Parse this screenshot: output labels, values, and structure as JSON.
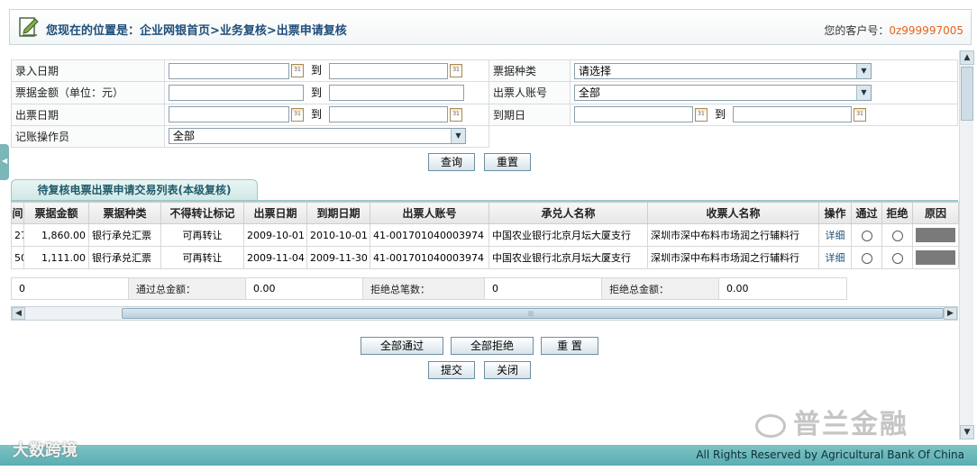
{
  "header": {
    "location": "您现在的位置是：企业网银首页>业务复核>出票申请复核",
    "customer_label": "您的客户号：",
    "customer_number": "0z999997005"
  },
  "form": {
    "to_label": "到",
    "entry_date_label": "录入日期",
    "bill_type_label": "票据种类",
    "bill_type_value": "请选择",
    "amount_label": "票据金额（单位：元）",
    "drawer_account_label": "出票人账号",
    "drawer_account_value": "全部",
    "issue_date_label": "出票日期",
    "due_date_label": "到期日",
    "operator_label": "记账操作员",
    "operator_value": "全部",
    "query_button": "查询",
    "reset_button": "重置"
  },
  "list": {
    "tab_title": "待复核电票出票申请交易列表(本级复核)",
    "columns": [
      "间",
      "票据金额",
      "票据种类",
      "不得转让标记",
      "出票日期",
      "到期日期",
      "出票人账号",
      "承兑人名称",
      "收票人名称",
      "操作",
      "通过",
      "拒绝",
      "原因"
    ],
    "rows": [
      {
        "seq": "27",
        "amount": "1,860.00",
        "type": "银行承兑汇票",
        "flag": "可再转让",
        "issue": "2009-10-01",
        "due": "2010-10-01",
        "account": "41-001701040003974",
        "acceptor": "中国农业银行北京月坛大厦支行",
        "payee": "深圳市深中布料市场润之行辅料行",
        "action": "详细"
      },
      {
        "seq": "50",
        "amount": "1,111.00",
        "type": "银行承兑汇票",
        "flag": "可再转让",
        "issue": "2009-11-04",
        "due": "2009-11-30",
        "account": "41-001701040003974",
        "acceptor": "中国农业银行北京月坛大厦支行",
        "payee": "深圳市深中布料市场润之行辅料行",
        "action": "详细"
      }
    ]
  },
  "summary": {
    "count": "0",
    "pass_amount_label": "通过总金额：",
    "pass_amount": "0.00",
    "reject_count_label": "拒绝总笔数：",
    "reject_count": "0",
    "reject_amount_label": "拒绝总金额：",
    "reject_amount": "0.00"
  },
  "actions": {
    "pass_all": "全部通过",
    "reject_all": "全部拒绝",
    "reset": "重 置",
    "submit": "提交",
    "close": "关闭"
  },
  "footer": {
    "copyright": "All Rights Reserved by Agricultural Bank Of China"
  },
  "watermarks": {
    "left": "大数跨境",
    "right": "普兰金融"
  }
}
